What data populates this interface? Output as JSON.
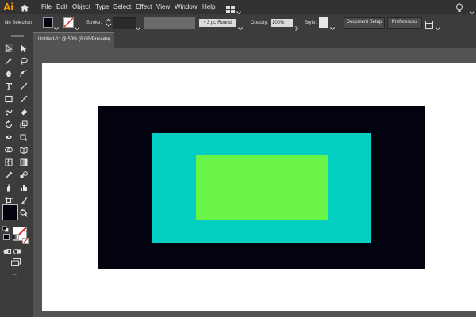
{
  "app": {
    "logo": "Ai"
  },
  "menu": [
    "File",
    "Edit",
    "Object",
    "Type",
    "Select",
    "Effect",
    "View",
    "Window",
    "Help"
  ],
  "control_bar": {
    "selection_status": "No Selection",
    "stroke_label": "Stroke:",
    "brush_label": "3 pt. Round",
    "opacity_label": "Opacity:",
    "opacity_value": "100%",
    "style_label": "Style:",
    "document_setup": "Document Setup",
    "preferences": "Preferences"
  },
  "document_tab": {
    "title": "Untitled-1* @ 50% (RGB/Preview)",
    "close": "×"
  },
  "toolbar": {
    "tools": [
      "selection-tool",
      "direct-selection-tool",
      "magic-wand-tool",
      "lasso-tool",
      "pen-tool",
      "curvature-tool",
      "type-tool",
      "line-segment-tool",
      "rectangle-tool",
      "paintbrush-tool",
      "shaper-tool",
      "eraser-tool",
      "rotate-tool",
      "scale-tool",
      "width-tool",
      "free-transform-tool",
      "shape-builder-tool",
      "perspective-grid-tool",
      "mesh-tool",
      "gradient-tool",
      "eyedropper-tool",
      "blend-tool",
      "symbol-sprayer-tool",
      "column-graph-tool",
      "artboard-tool",
      "slice-tool",
      "hand-tool",
      "zoom-tool"
    ],
    "more": "..."
  },
  "colors": {
    "fill": "#02030e",
    "shape_outer": "#02030e",
    "shape_middle": "#02cfc2",
    "shape_inner": "#6af44a",
    "artboard": "#ffffff",
    "app_logo": "#ff9a00"
  }
}
